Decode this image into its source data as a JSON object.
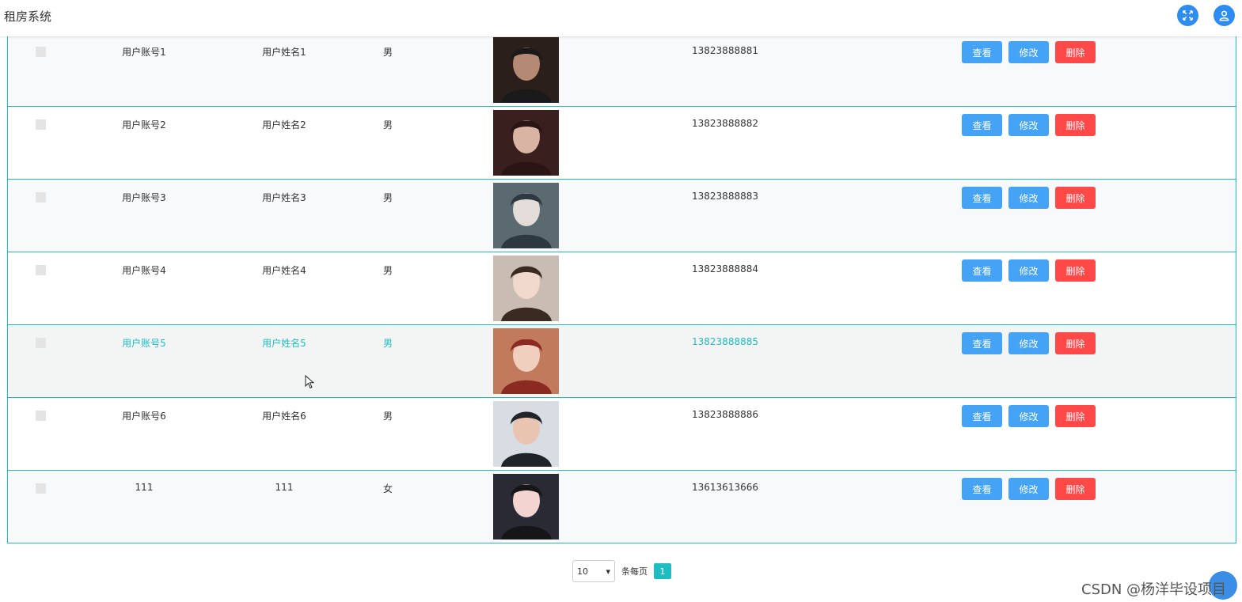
{
  "header": {
    "title": "租房系统",
    "icons": [
      "fullscreen-icon",
      "user-icon"
    ],
    "accent": "#2d8cf0"
  },
  "table": {
    "rows": [
      {
        "account": "用户账号1",
        "name": "用户姓名1",
        "sex": "男",
        "phone": "13823888881"
      },
      {
        "account": "用户账号2",
        "name": "用户姓名2",
        "sex": "男",
        "phone": "13823888882"
      },
      {
        "account": "用户账号3",
        "name": "用户姓名3",
        "sex": "男",
        "phone": "13823888883"
      },
      {
        "account": "用户账号4",
        "name": "用户姓名4",
        "sex": "男",
        "phone": "13823888884"
      },
      {
        "account": "用户账号5",
        "name": "用户姓名5",
        "sex": "男",
        "phone": "13823888885"
      },
      {
        "account": "用户账号6",
        "name": "用户姓名6",
        "sex": "男",
        "phone": "13823888886"
      },
      {
        "account": "111",
        "name": "111",
        "sex": "女",
        "phone": "13613613666"
      }
    ],
    "actions": {
      "view": "查看",
      "edit": "修改",
      "delete": "删除"
    },
    "border_color": "#1fbcc2"
  },
  "pagination": {
    "page_size": "10",
    "per_page_label": "条每页",
    "current_page": "1"
  },
  "watermark": "CSDN @杨洋毕设项目"
}
